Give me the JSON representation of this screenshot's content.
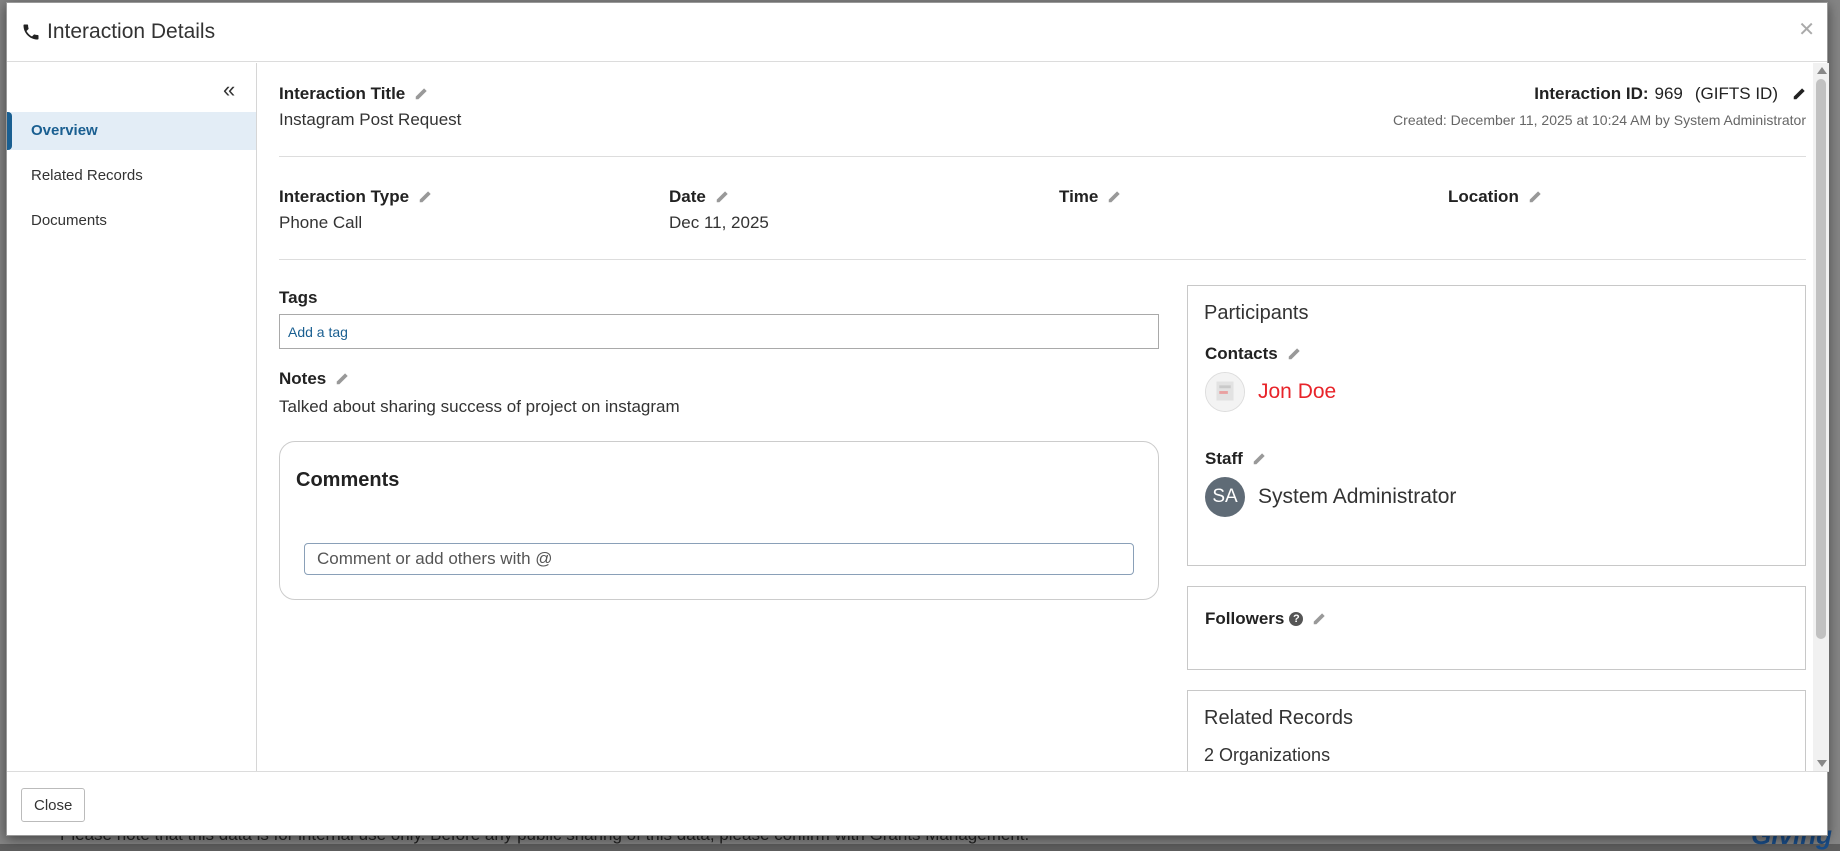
{
  "background": {
    "footer_note": "Please note that this data is for internal use only. Before any public sharing of this data, please confirm with Grants Management.",
    "brand_text": "Giving"
  },
  "modal": {
    "title": "Interaction Details",
    "close_label": "Close"
  },
  "sidebar": {
    "items": [
      {
        "label": "Overview",
        "active": true
      },
      {
        "label": "Related Records",
        "active": false
      },
      {
        "label": "Documents",
        "active": false
      }
    ]
  },
  "interaction": {
    "title_label": "Interaction Title",
    "title_value": "Instagram Post Request",
    "id_label": "Interaction ID:",
    "id_value": "969",
    "gifts_id_label": "(GIFTS ID)",
    "created": "Created: December 11, 2025 at 10:24 AM by System Administrator",
    "type_label": "Interaction Type",
    "type_value": "Phone Call",
    "date_label": "Date",
    "date_value": "Dec 11, 2025",
    "time_label": "Time",
    "time_value": "",
    "location_label": "Location",
    "location_value": ""
  },
  "tags": {
    "label": "Tags",
    "placeholder": "Add a tag"
  },
  "notes": {
    "label": "Notes",
    "value": "Talked about sharing success of project on instagram"
  },
  "comments": {
    "title": "Comments",
    "placeholder": "Comment or add others with @"
  },
  "participants": {
    "title": "Participants",
    "contacts_label": "Contacts",
    "contact_name": "Jon Doe",
    "staff_label": "Staff",
    "staff_initials": "SA",
    "staff_name": "System Administrator"
  },
  "followers": {
    "label": "Followers",
    "help": "?"
  },
  "related_records": {
    "title": "Related Records",
    "summary": "2 Organizations"
  },
  "colors": {
    "accent": "#1a5f91",
    "contact_link": "#e8242a",
    "staff_avatar": "#5f6b76"
  }
}
